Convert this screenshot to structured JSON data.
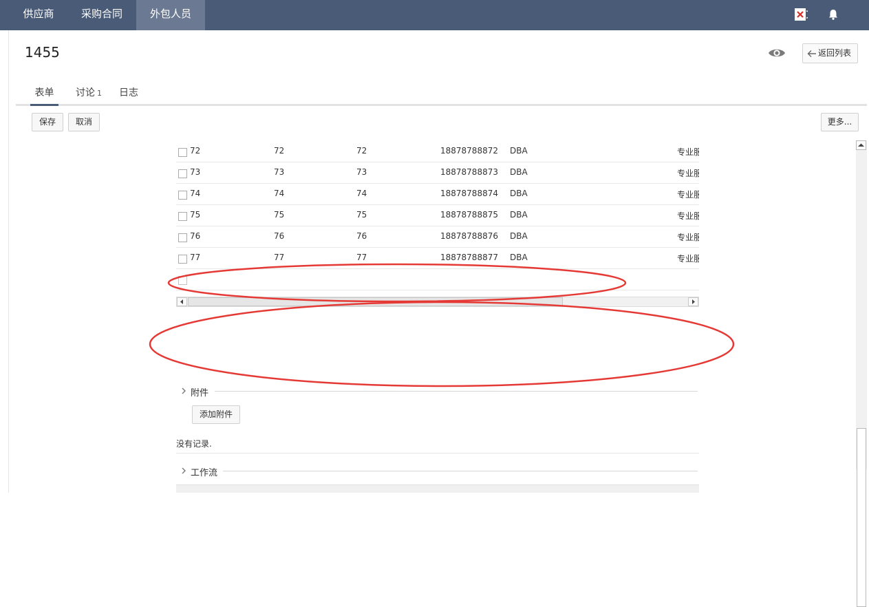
{
  "nav": {
    "tabs": [
      {
        "label": "供应商"
      },
      {
        "label": "采购合同"
      },
      {
        "label": "外包人员",
        "active": true
      }
    ]
  },
  "record": {
    "title": "1455",
    "back_label": "返回列表"
  },
  "tabs": {
    "form": "表单",
    "discussion": "讨论",
    "discussion_count": "1",
    "log": "日志"
  },
  "toolbar": {
    "save": "保存",
    "cancel": "取消",
    "more": "更多..."
  },
  "table": {
    "rows": [
      [
        "72",
        "72",
        "72",
        "18878788872",
        "DBA",
        "专业服"
      ],
      [
        "73",
        "73",
        "73",
        "18878788873",
        "DBA",
        "专业服"
      ],
      [
        "74",
        "74",
        "74",
        "18878788874",
        "DBA",
        "专业服"
      ],
      [
        "75",
        "75",
        "75",
        "18878788875",
        "DBA",
        "专业服"
      ],
      [
        "76",
        "76",
        "76",
        "18878788876",
        "DBA",
        "专业服"
      ],
      [
        "77",
        "77",
        "77",
        "18878788877",
        "DBA",
        "专业服"
      ]
    ]
  },
  "attachments": {
    "title": "附件",
    "add_label": "添加附件",
    "empty_text": "没有记录."
  },
  "workflow": {
    "title": "工作流"
  },
  "colors": {
    "topbar": "#4a5b78",
    "active_tab": "#6b7a92",
    "annotation": "#e53935"
  },
  "icons": [
    "close-red-icon",
    "bell-icon",
    "eye-icon",
    "arrow-left-icon",
    "chevron-right-icon"
  ]
}
